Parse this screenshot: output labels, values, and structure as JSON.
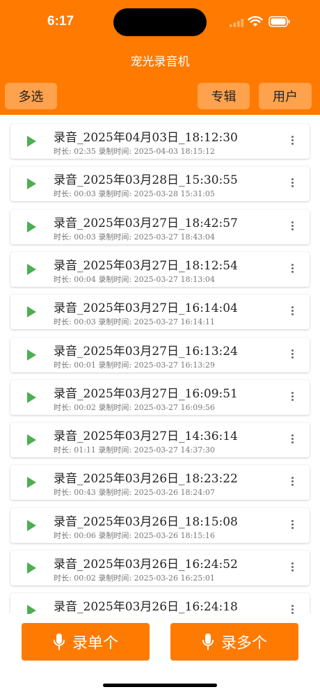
{
  "status": {
    "time": "6:17"
  },
  "header": {
    "title": "宠光录音机",
    "multi_select": "多选",
    "album": "专辑",
    "user": "用户"
  },
  "recordings": [
    {
      "title": "录音_2025年04月03日_18:12:30",
      "meta": "时长: 02:35 录制时间: 2025-04-03 18:15:12"
    },
    {
      "title": "录音_2025年03月28日_15:30:55",
      "meta": "时长: 00:03 录制时间: 2025-03-28 15:31:05"
    },
    {
      "title": "录音_2025年03月27日_18:42:57",
      "meta": "时长: 00:03 录制时间: 2025-03-27 18:43:04"
    },
    {
      "title": "录音_2025年03月27日_18:12:54",
      "meta": "时长: 00:04 录制时间: 2025-03-27 18:13:04"
    },
    {
      "title": "录音_2025年03月27日_16:14:04",
      "meta": "时长: 00:03 录制时间: 2025-03-27 16:14:11"
    },
    {
      "title": "录音_2025年03月27日_16:13:24",
      "meta": "时长: 00:01 录制时间: 2025-03-27 16:13:29"
    },
    {
      "title": "录音_2025年03月27日_16:09:51",
      "meta": "时长: 00:02 录制时间: 2025-03-27 16:09:56"
    },
    {
      "title": "录音_2025年03月27日_14:36:14",
      "meta": "时长: 01:11 录制时间: 2025-03-27 14:37:30"
    },
    {
      "title": "录音_2025年03月26日_18:23:22",
      "meta": "时长: 00:43 录制时间: 2025-03-26 18:24:07"
    },
    {
      "title": "录音_2025年03月26日_18:15:08",
      "meta": "时长: 00:06 录制时间: 2025-03-26 18:15:16"
    },
    {
      "title": "录音_2025年03月26日_16:24:52",
      "meta": "时长: 00:02 录制时间: 2025-03-26 16:25:01"
    },
    {
      "title": "录音_2025年03月26日_16:24:18",
      "meta": ""
    }
  ],
  "bottom": {
    "record_single": "录单个",
    "record_multiple": "录多个"
  },
  "colors": {
    "accent": "#ff7a00",
    "header_button": "#ffa24d",
    "play": "#4caf50"
  },
  "icons": {
    "play": "play-icon",
    "menu": "more-vertical-icon",
    "mic": "microphone-icon"
  }
}
